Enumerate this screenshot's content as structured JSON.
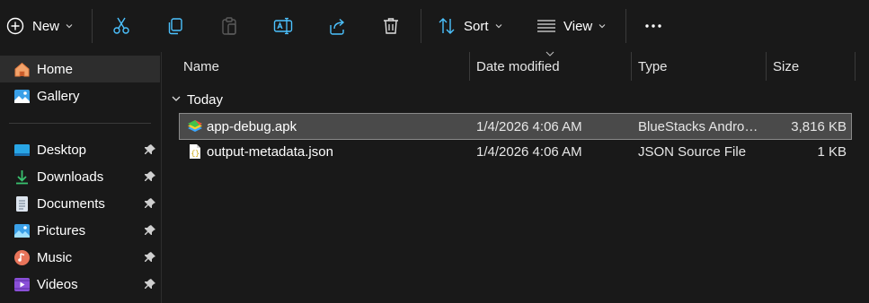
{
  "toolbar": {
    "new_label": "New",
    "sort_label": "Sort",
    "view_label": "View"
  },
  "sidebar": {
    "items": [
      {
        "label": "Home"
      },
      {
        "label": "Gallery"
      },
      {
        "label": "Desktop"
      },
      {
        "label": "Downloads"
      },
      {
        "label": "Documents"
      },
      {
        "label": "Pictures"
      },
      {
        "label": "Music"
      },
      {
        "label": "Videos"
      }
    ]
  },
  "columns": {
    "name": "Name",
    "date": "Date modified",
    "type": "Type",
    "size": "Size"
  },
  "group": {
    "label": "Today"
  },
  "files": [
    {
      "name": "app-debug.apk",
      "date": "1/4/2026 4:06 AM",
      "type": "BlueStacks Android PacKage",
      "size": "3,816 KB"
    },
    {
      "name": "output-metadata.json",
      "date": "1/4/2026 4:06 AM",
      "type": "JSON Source File",
      "size": "1 KB"
    }
  ],
  "colors": {
    "background": "#191919",
    "selected_row": "#4a4a4a",
    "accent": "#4cc2ff"
  }
}
